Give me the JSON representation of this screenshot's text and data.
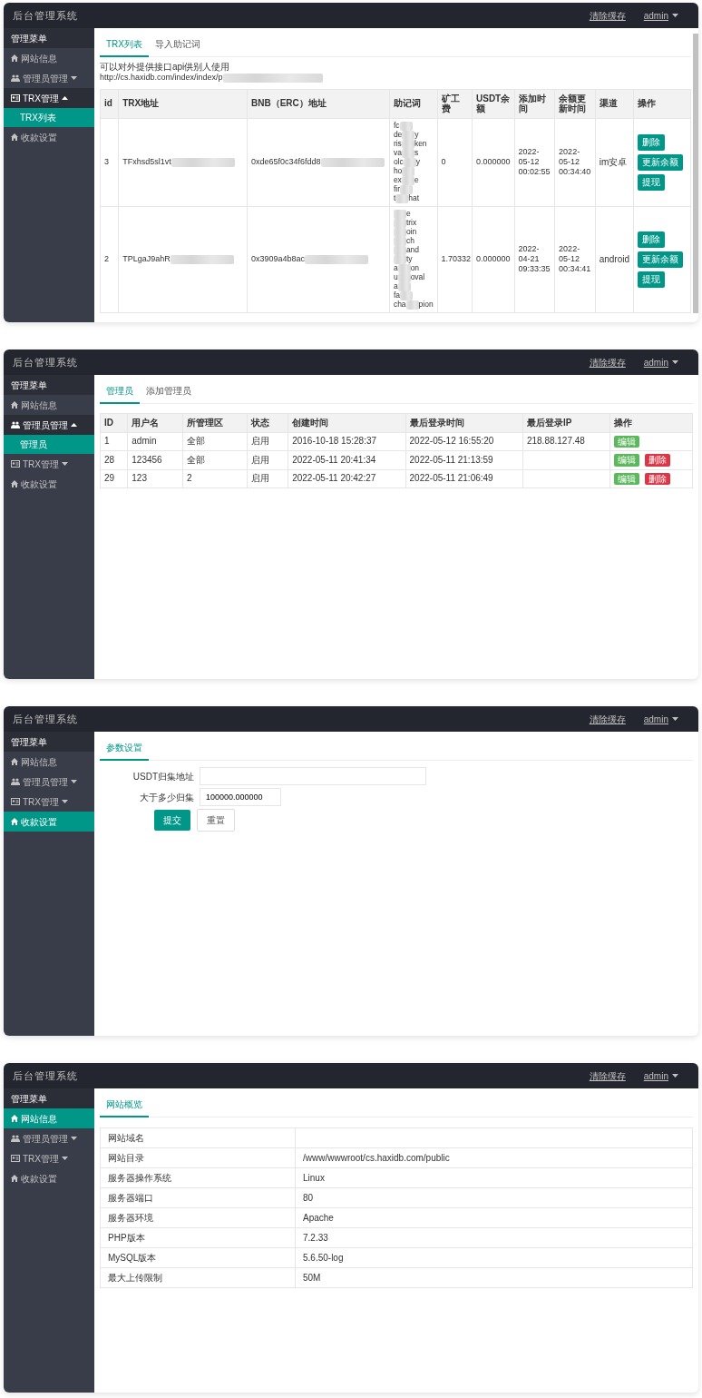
{
  "panels": [
    {
      "brand": "后台管理系统",
      "header_link": "清除缓存",
      "user": "admin",
      "sidebar": {
        "title": "管理菜单",
        "items": [
          {
            "label": "网站信息",
            "selected": false
          },
          {
            "label": "管理员管理",
            "selected": false,
            "expanded": false
          },
          {
            "label": "TRX管理",
            "selected": false,
            "expanded": true,
            "children": [
              {
                "label": "TRX列表",
                "selected": true
              }
            ]
          },
          {
            "label": "收款设置",
            "selected": false
          }
        ]
      },
      "tabs": [
        {
          "label": "TRX列表",
          "selected": true
        },
        {
          "label": "导入助记词",
          "selected": false
        }
      ],
      "content": {
        "kind": "trx_table",
        "note": "可以对外提供接口api供别人使用",
        "url": "http://cs.haxidb.com/index/index/p",
        "columns": [
          "id",
          "TRX地址",
          "BNB（ERC）地址",
          "助记词",
          "矿工费",
          "USDT余额",
          "添加时间",
          "余额更新时间",
          "渠道",
          "操作"
        ],
        "rows": [
          {
            "id": "3",
            "trx": "TFxhsd5sl1vt",
            "bnb": "0xde65f0c34f6fdd8",
            "mnemonic": [
              {
                "left": "fc"
              },
              {
                "left": "de",
                "right": "y"
              },
              {
                "left": "ris",
                "right": "ken"
              },
              {
                "left": "va",
                "right": "s"
              },
              {
                "left": "olc",
                "right": "y"
              },
              {
                "left": "ho"
              },
              {
                "left": "ex",
                "right": "e"
              },
              {
                "left": "fir"
              },
              {
                "left": "t",
                "right": "hat"
              }
            ],
            "fee": "0",
            "usdt": "0.000000",
            "added": "2022-05-12 00:02:55",
            "updated": "2022-05-12 00:34:40",
            "channel": "im安卓",
            "actions": [
              {
                "label": "删除",
                "kind": "primary"
              },
              {
                "label": "更新余额",
                "kind": "primary"
              },
              {
                "label": "提现",
                "kind": "primary"
              }
            ]
          },
          {
            "id": "2",
            "trx": "TPLgaJ9ahR",
            "bnb": "0x3909a4b8ac",
            "mnemonic": [
              {
                "right": "e"
              },
              {
                "right": "trix"
              },
              {
                "right": "oin"
              },
              {
                "right": "ch"
              },
              {
                "right": "and"
              },
              {
                "right": "ty"
              },
              {
                "left": "a",
                "right": "on"
              },
              {
                "left": "u",
                "right": "oval"
              },
              {
                "left": "a"
              },
              {
                "left": "fa"
              },
              {
                "left": "cha",
                "right": "pion"
              }
            ],
            "fee": "1.70332",
            "usdt": "0.000000",
            "added": "2022-04-21 09:33:35",
            "updated": "2022-05-12 00:34:41",
            "channel": "android",
            "actions": [
              {
                "label": "删除",
                "kind": "primary"
              },
              {
                "label": "更新余额",
                "kind": "primary"
              },
              {
                "label": "提现",
                "kind": "primary"
              }
            ]
          }
        ]
      }
    },
    {
      "brand": "后台管理系统",
      "header_link": "清除缓存",
      "user": "admin",
      "sidebar": {
        "title": "管理菜单",
        "items": [
          {
            "label": "网站信息",
            "selected": false
          },
          {
            "label": "管理员管理",
            "selected": false,
            "expanded": true,
            "children": [
              {
                "label": "管理员",
                "selected": true
              }
            ]
          },
          {
            "label": "TRX管理",
            "selected": false,
            "expanded": false
          },
          {
            "label": "收款设置",
            "selected": false
          }
        ]
      },
      "tabs": [
        {
          "label": "管理员",
          "selected": true
        },
        {
          "label": "添加管理员",
          "selected": false
        }
      ],
      "content": {
        "kind": "admin_table",
        "columns": [
          "ID",
          "用户名",
          "所管理区",
          "状态",
          "创建时间",
          "最后登录时间",
          "最后登录IP",
          "操作"
        ],
        "rows": [
          {
            "cells": [
              "1",
              "admin",
              "全部",
              "启用",
              "2016-10-18 15:28:37",
              "2022-05-12 16:55:20",
              "218.88.127.48"
            ],
            "actions": [
              {
                "label": "编辑",
                "kind": "success"
              }
            ]
          },
          {
            "cells": [
              "28",
              "123456",
              "全部",
              "启用",
              "2022-05-11 20:41:34",
              "2022-05-11 21:13:59",
              null
            ],
            "actions": [
              {
                "label": "编辑",
                "kind": "success"
              },
              {
                "label": "删除",
                "kind": "danger"
              }
            ]
          },
          {
            "cells": [
              "29",
              "123",
              "2",
              "启用",
              "2022-05-11 20:42:27",
              "2022-05-11 21:06:49",
              null
            ],
            "actions": [
              {
                "label": "编辑",
                "kind": "success"
              },
              {
                "label": "删除",
                "kind": "danger"
              }
            ]
          }
        ]
      }
    },
    {
      "brand": "后台管理系统",
      "header_link": "清除缓存",
      "user": "admin",
      "sidebar": {
        "title": "管理菜单",
        "items": [
          {
            "label": "网站信息",
            "selected": false
          },
          {
            "label": "管理员管理",
            "selected": false,
            "expanded": false
          },
          {
            "label": "TRX管理",
            "selected": false,
            "expanded": false
          },
          {
            "label": "收款设置",
            "selected": true
          }
        ]
      },
      "tabs": [
        {
          "label": "参数设置",
          "selected": true
        }
      ],
      "content": {
        "kind": "settings_form",
        "fields": [
          {
            "label": "USDT归集地址"
          },
          {
            "label": "大于多少归集",
            "value": "100000.000000"
          }
        ],
        "buttons": [
          {
            "label": "提交",
            "kind": "primary"
          },
          {
            "label": "重置",
            "kind": "plain"
          }
        ]
      }
    },
    {
      "brand": "后台管理系统",
      "header_link": "清除缓存",
      "user": "admin",
      "sidebar": {
        "title": "管理菜单",
        "items": [
          {
            "label": "网站信息",
            "selected": true
          },
          {
            "label": "管理员管理",
            "selected": false,
            "expanded": false
          },
          {
            "label": "TRX管理",
            "selected": false,
            "expanded": false
          },
          {
            "label": "收款设置",
            "selected": false
          }
        ]
      },
      "tabs": [
        {
          "label": "网站概览",
          "selected": true
        }
      ],
      "content": {
        "kind": "info_table",
        "rows": [
          {
            "label": "网站域名"
          },
          {
            "label": "网站目录",
            "value": "/www/wwwroot/cs.haxidb.com/public"
          },
          {
            "label": "服务器操作系统",
            "value": "Linux"
          },
          {
            "label": "服务器端口",
            "value": "80"
          },
          {
            "label": "服务器环境",
            "value": "Apache"
          },
          {
            "label": "PHP版本",
            "value": "7.2.33"
          },
          {
            "label": "MySQL版本",
            "value": "5.6.50-log"
          },
          {
            "label": "最大上传限制",
            "value": "50M"
          }
        ]
      }
    }
  ]
}
